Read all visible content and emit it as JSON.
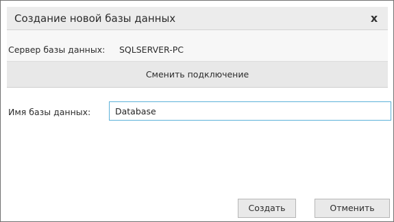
{
  "dialog": {
    "title": "Создание новой базы данных",
    "close_icon_glyph": "x"
  },
  "server": {
    "label": "Сервер базы данных:",
    "value": "SQLSERVER-PC"
  },
  "change_connection": {
    "label": "Сменить подключение"
  },
  "database_name": {
    "label": "Имя базы данных:",
    "value": "Database"
  },
  "buttons": {
    "create_label": "Создать",
    "cancel_label": "Отменить"
  },
  "colors": {
    "input_focus_border": "#5ab0d8",
    "titlebar_bg": "#ececec",
    "button_bg": "#e9e9e9"
  }
}
